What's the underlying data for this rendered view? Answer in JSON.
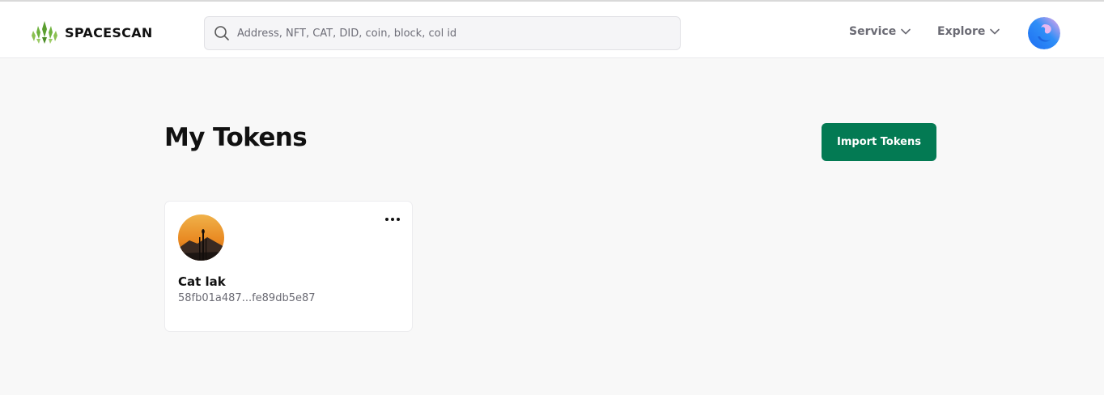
{
  "header": {
    "brand": "SPACESCAN",
    "search": {
      "placeholder": "Address, NFT, CAT, DID, coin, block, col id",
      "value": ""
    },
    "nav": [
      {
        "label": "Service",
        "icon": "chevron-down-icon"
      },
      {
        "label": "Explore",
        "icon": "chevron-down-icon"
      }
    ],
    "avatar_icon": "user-avatar"
  },
  "main": {
    "title": "My Tokens",
    "import_button_label": "Import Tokens",
    "tokens": [
      {
        "name": "Cat lak",
        "id": "58fb01a487...fe89db5e87",
        "menu_icon": "more-horizontal-icon"
      }
    ]
  },
  "colors": {
    "accent": "#037a53",
    "background": "#f8f8f8",
    "muted_text": "#6b6b74"
  }
}
